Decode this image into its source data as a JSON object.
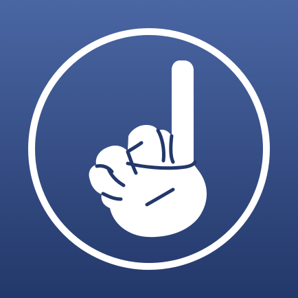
{
  "icon": {
    "name": "pointing-finger-icon",
    "colors": {
      "background_top": "#4A66A3",
      "background_bottom": "#23386A",
      "foreground": "#FFFFFF",
      "hand_outline": "#23386A"
    }
  }
}
